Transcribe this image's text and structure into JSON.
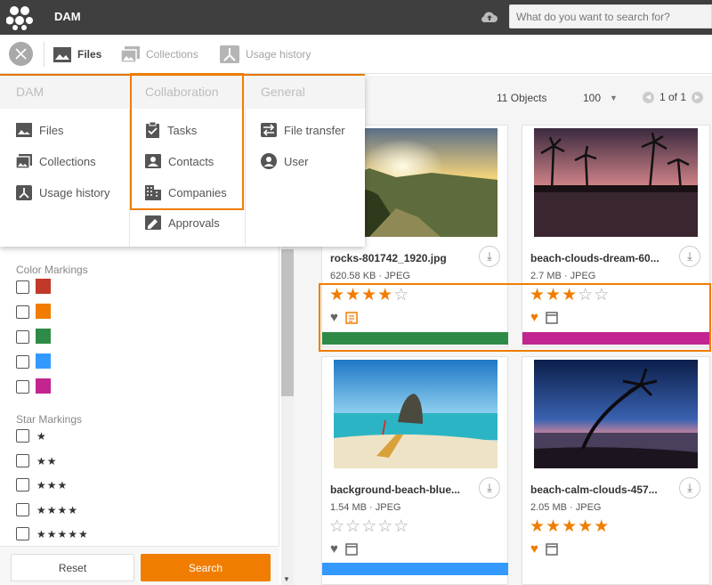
{
  "app": {
    "name": "DAM"
  },
  "search": {
    "placeholder": "What do you want to search for?"
  },
  "nav": {
    "files": "Files",
    "collections": "Collections",
    "usage_history": "Usage history"
  },
  "menu": {
    "columns": [
      {
        "title": "DAM",
        "items": [
          "Files",
          "Collections",
          "Usage history"
        ]
      },
      {
        "title": "Collaboration",
        "items": [
          "Tasks",
          "Contacts",
          "Companies",
          "Approvals"
        ]
      },
      {
        "title": "General",
        "items": [
          "File transfer",
          "User"
        ]
      }
    ]
  },
  "filters": {
    "color_title": "Color Markings",
    "colors": [
      "#c0392b",
      "#f07d00",
      "#2e8b47",
      "#3399ff",
      "#c2258f"
    ],
    "star_title": "Star Markings",
    "star_labels": [
      "★",
      "★★",
      "★★★",
      "★★★★",
      "★★★★★"
    ],
    "reset": "Reset",
    "search": "Search"
  },
  "toolbar": {
    "objects": "11  Objects",
    "page_size": "100",
    "page": "1 of 1"
  },
  "cards": [
    {
      "name": "rocks-801742_1920.jpg",
      "meta": "620.58 KB · JPEG",
      "rating": 0.8,
      "favorite": false,
      "note": true,
      "color": "#2e8b47"
    },
    {
      "name": "beach-clouds-dream-60...",
      "meta": "2.7 MB · JPEG",
      "rating": 0.6,
      "favorite": true,
      "note": false,
      "color": "#c2258f"
    },
    {
      "name": "background-beach-blue...",
      "meta": "1.54 MB · JPEG",
      "rating": 0,
      "favorite": false,
      "note": false,
      "color": "#3399ff"
    },
    {
      "name": "beach-calm-clouds-457...",
      "meta": "2.05 MB · JPEG",
      "rating": 1.0,
      "favorite": true,
      "note": false,
      "color": ""
    }
  ]
}
